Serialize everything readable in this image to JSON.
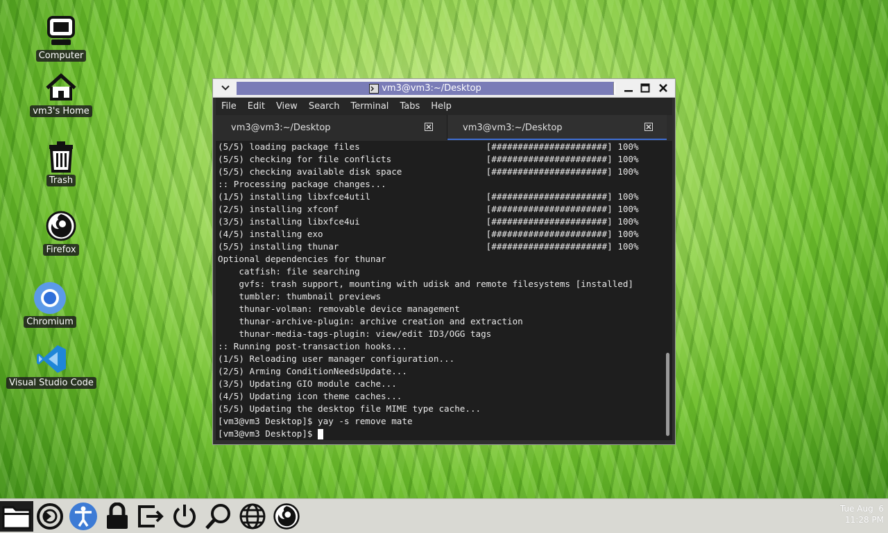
{
  "desktop": {
    "icons": [
      {
        "label": "Computer",
        "icon": "computer-icon"
      },
      {
        "label": "vm3's Home",
        "icon": "home-icon"
      },
      {
        "label": "Trash",
        "icon": "trash-icon"
      },
      {
        "label": "Firefox",
        "icon": "firefox-icon"
      },
      {
        "label": "Chromium",
        "icon": "chromium-icon"
      },
      {
        "label": "Visual Studio Code",
        "icon": "vscode-icon"
      }
    ]
  },
  "window": {
    "title": "vm3@vm3:~/Desktop",
    "menu": [
      "File",
      "Edit",
      "View",
      "Search",
      "Terminal",
      "Tabs",
      "Help"
    ],
    "tabs": [
      {
        "label": "vm3@vm3:~/Desktop",
        "active": false
      },
      {
        "label": "vm3@vm3:~/Desktop",
        "active": true
      }
    ],
    "terminal_lines": [
      "(5/5) loading package files                        [######################] 100%",
      "(5/5) checking for file conflicts                  [######################] 100%",
      "(5/5) checking available disk space                [######################] 100%",
      ":: Processing package changes...",
      "(1/5) installing libxfce4util                      [######################] 100%",
      "(2/5) installing xfconf                            [######################] 100%",
      "(3/5) installing libxfce4ui                        [######################] 100%",
      "(4/5) installing exo                               [######################] 100%",
      "(5/5) installing thunar                            [######################] 100%",
      "Optional dependencies for thunar",
      "    catfish: file searching",
      "    gvfs: trash support, mounting with udisk and remote filesystems [installed]",
      "    tumbler: thumbnail previews",
      "    thunar-volman: removable device management",
      "    thunar-archive-plugin: archive creation and extraction",
      "    thunar-media-tags-plugin: view/edit ID3/OGG tags",
      ":: Running post-transaction hooks...",
      "(1/5) Reloading user manager configuration...",
      "(2/5) Arming ConditionNeedsUpdate...",
      "(3/5) Updating GIO module cache...",
      "(4/5) Updating icon theme caches...",
      "(5/5) Updating the desktop file MIME type cache...",
      "[vm3@vm3 Desktop]$ yay -s remove mate"
    ],
    "prompt": "[vm3@vm3 Desktop]$ "
  },
  "taskbar": {
    "items": [
      "file-manager-icon",
      "refresh-icon",
      "accessibility-icon",
      "lock-icon",
      "logout-icon",
      "power-icon",
      "search-icon",
      "globe-icon",
      "firefox-icon"
    ],
    "clock": {
      "date": "Tue Aug  6",
      "time": "11:28 PM"
    }
  }
}
